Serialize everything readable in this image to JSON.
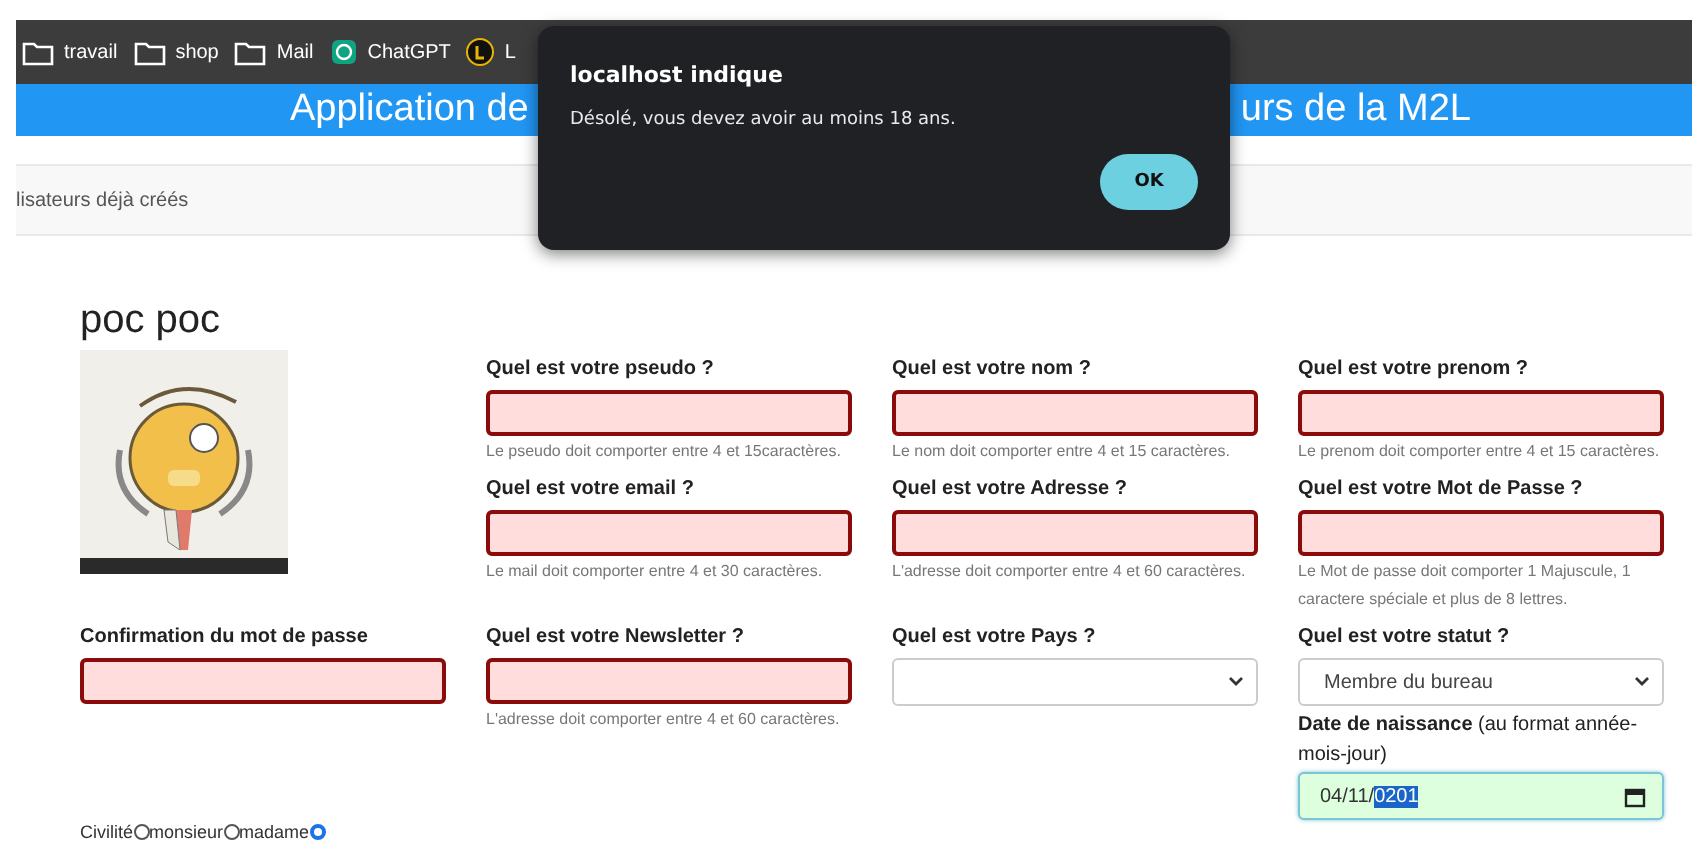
{
  "bookmarks": [
    {
      "label": "travail",
      "kind": "folder"
    },
    {
      "label": "shop",
      "kind": "folder"
    },
    {
      "label": "Mail",
      "kind": "folder"
    },
    {
      "label": "ChatGPT",
      "kind": "chatgpt"
    },
    {
      "label": "L",
      "kind": "letter"
    }
  ],
  "banner": {
    "left_text": "Application de",
    "right_text": "urs de la M2L"
  },
  "nav": {
    "text": "lisateurs déjà créés"
  },
  "heading": "poc poc",
  "picture": {
    "kind": "picture"
  },
  "cells": [
    [
      {
        "kind": "text",
        "label": "Quel est votre pseudo ?",
        "invalid": true,
        "help": "Le pseudo doit comporter entre 4 et 15caractères."
      }
    ],
    [
      {
        "kind": "text",
        "label": "Quel est votre nom ?",
        "invalid": true,
        "help": "Le nom doit comporter entre 4 et 15 caractères."
      }
    ],
    [
      {
        "kind": "text",
        "label": "Quel est votre prenom ?",
        "invalid": true,
        "help": "Le prenom doit comporter entre 4 et 15 caractères."
      }
    ],
    [
      {
        "kind": "text",
        "label": "Quel est votre email ?",
        "invalid": true,
        "help": "Le mail doit comporter entre 4 et 30 caractères."
      }
    ],
    [
      {
        "kind": "text",
        "label": "Quel est votre Adresse ?",
        "invalid": true,
        "help": "L'adresse doit comporter entre 4 et 60 caractères."
      }
    ],
    [
      {
        "kind": "text",
        "label": "Quel est votre Mot de Passe ?",
        "invalid": true,
        "help": "Le Mot de passe doit comporter 1 Majuscule, 1 caractere spéciale et plus de 8 lettres."
      }
    ],
    [
      {
        "kind": "text",
        "label": "Confirmation du mot de passe",
        "invalid": true
      }
    ],
    [
      {
        "kind": "text",
        "label": "Quel est votre Newsletter ?",
        "invalid": true,
        "help": "L'adresse doit comporter entre 4 et 60 caractères."
      }
    ],
    [
      {
        "kind": "select",
        "label": "Quel est votre Pays ?"
      }
    ],
    [
      {
        "kind": "select",
        "label": "Quel est votre statut ?",
        "value": "Membre du bureau"
      },
      {
        "kind": "date",
        "label": "**Date de naissance** (au format année-mois-jour)",
        "valid": true,
        "value_parts": [
          {
            "text": "04/11/",
            "selected": false
          },
          {
            "text": "0201",
            "selected": true
          }
        ]
      }
    ]
  ],
  "civilite": {
    "label": "Civilité",
    "options": [
      {
        "label": "monsieur",
        "selected": false
      },
      {
        "label": "madame",
        "selected": false
      },
      {
        "selected": true
      }
    ]
  },
  "dialog": {
    "title": "localhost indique",
    "message": "Désolé, vous devez avoir au moins 18 ans.",
    "button": "OK"
  }
}
